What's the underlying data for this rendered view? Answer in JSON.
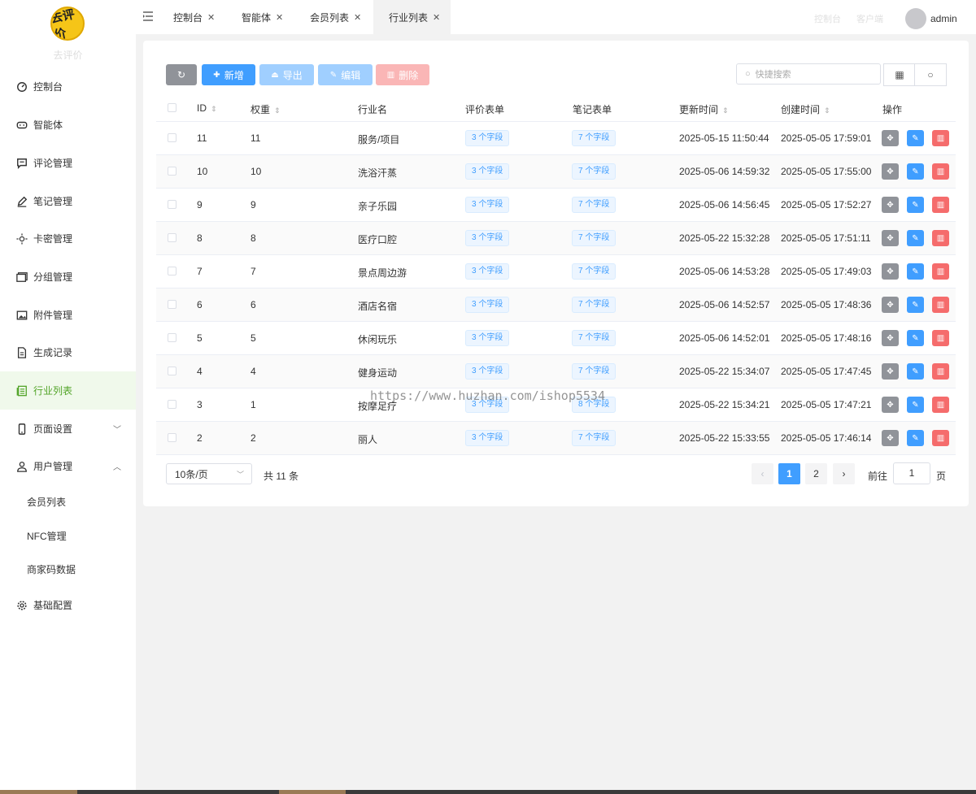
{
  "brand": {
    "logo_alt": "logo",
    "name": "去评价"
  },
  "sidebar": {
    "items": [
      {
        "label": "控制台",
        "icon": "dashboard-icon"
      },
      {
        "label": "智能体",
        "icon": "gamepad-icon"
      },
      {
        "label": "评论管理",
        "icon": "comment-icon"
      },
      {
        "label": "笔记管理",
        "icon": "pen-icon"
      },
      {
        "label": "卡密管理",
        "icon": "sun-icon"
      },
      {
        "label": "分组管理",
        "icon": "folder-icon"
      },
      {
        "label": "附件管理",
        "icon": "image-icon"
      },
      {
        "label": "生成记录",
        "icon": "file-icon"
      },
      {
        "label": "行业列表",
        "icon": "list-icon"
      },
      {
        "label": "页面设置",
        "icon": "phone-icon"
      },
      {
        "label": "用户管理",
        "icon": "user-icon"
      },
      {
        "label": "基础配置",
        "icon": "gear-icon"
      }
    ],
    "subitems": [
      "会员列表",
      "NFC管理",
      "商家码数据"
    ]
  },
  "tabs": [
    {
      "label": "控制台"
    },
    {
      "label": "智能体"
    },
    {
      "label": "会员列表"
    },
    {
      "label": "行业列表"
    }
  ],
  "topbar": {
    "link1": "控制台",
    "link2": "客户端",
    "username": "admin"
  },
  "toolbar": {
    "refresh": "",
    "add": "新增",
    "export": "导出",
    "edit": "编辑",
    "delete": "删除",
    "search_placeholder": "快捷搜索"
  },
  "table": {
    "headers": {
      "id": "ID",
      "weight": "权重",
      "name": "行业名",
      "review": "评价表单",
      "note": "笔记表单",
      "updated": "更新时间",
      "created": "创建时间",
      "ops": "操作"
    },
    "rows": [
      {
        "id": "11",
        "weight": "11",
        "name": "服务/项目",
        "review": "3 个字段",
        "note": "7 个字段",
        "updated": "2025-05-15 11:50:44",
        "created": "2025-05-05 17:59:01"
      },
      {
        "id": "10",
        "weight": "10",
        "name": "洗浴汗蒸",
        "review": "3 个字段",
        "note": "7 个字段",
        "updated": "2025-05-06 14:59:32",
        "created": "2025-05-05 17:55:00"
      },
      {
        "id": "9",
        "weight": "9",
        "name": "亲子乐园",
        "review": "3 个字段",
        "note": "7 个字段",
        "updated": "2025-05-06 14:56:45",
        "created": "2025-05-05 17:52:27"
      },
      {
        "id": "8",
        "weight": "8",
        "name": "医疗口腔",
        "review": "3 个字段",
        "note": "7 个字段",
        "updated": "2025-05-22 15:32:28",
        "created": "2025-05-05 17:51:11"
      },
      {
        "id": "7",
        "weight": "7",
        "name": "景点周边游",
        "review": "3 个字段",
        "note": "7 个字段",
        "updated": "2025-05-06 14:53:28",
        "created": "2025-05-05 17:49:03"
      },
      {
        "id": "6",
        "weight": "6",
        "name": "酒店名宿",
        "review": "3 个字段",
        "note": "7 个字段",
        "updated": "2025-05-06 14:52:57",
        "created": "2025-05-05 17:48:36"
      },
      {
        "id": "5",
        "weight": "5",
        "name": "休闲玩乐",
        "review": "3 个字段",
        "note": "7 个字段",
        "updated": "2025-05-06 14:52:01",
        "created": "2025-05-05 17:48:16"
      },
      {
        "id": "4",
        "weight": "4",
        "name": "健身运动",
        "review": "3 个字段",
        "note": "7 个字段",
        "updated": "2025-05-22 15:34:07",
        "created": "2025-05-05 17:47:45"
      },
      {
        "id": "3",
        "weight": "1",
        "name": "按摩足疗",
        "review": "3 个字段",
        "note": "8 个字段",
        "updated": "2025-05-22 15:34:21",
        "created": "2025-05-05 17:47:21"
      },
      {
        "id": "2",
        "weight": "2",
        "name": "丽人",
        "review": "3 个字段",
        "note": "7 个字段",
        "updated": "2025-05-22 15:33:55",
        "created": "2025-05-05 17:46:14"
      }
    ]
  },
  "pager": {
    "size": "10条/页",
    "total": "共 11 条",
    "pages": [
      "1",
      "2"
    ],
    "goto_label": "前往",
    "goto_value": "1",
    "goto_suffix": "页"
  },
  "watermark": "https://www.huzhan.com/ishop5534",
  "colors": {
    "primary": "#409eff",
    "active_menu": "#52a428",
    "danger": "#f56c6c",
    "neutral": "#909399"
  }
}
